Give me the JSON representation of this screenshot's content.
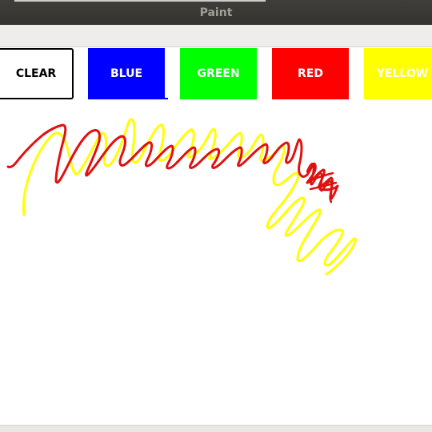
{
  "window": {
    "title": "Paint"
  },
  "toolbar": {
    "buttons": [
      {
        "label": "CLEAR",
        "color": "#ffffff"
      },
      {
        "label": "BLUE",
        "color": "#0000ff"
      },
      {
        "label": "GREEN",
        "color": "#00ff00"
      },
      {
        "label": "RED",
        "color": "#ff0000"
      },
      {
        "label": "YELLOW",
        "color": "#ffff00"
      }
    ]
  },
  "canvas": {
    "strokes": [
      {
        "name": "yellow-stroke",
        "color": "#ffff00"
      },
      {
        "name": "red-stroke",
        "color": "#e01010"
      }
    ]
  }
}
